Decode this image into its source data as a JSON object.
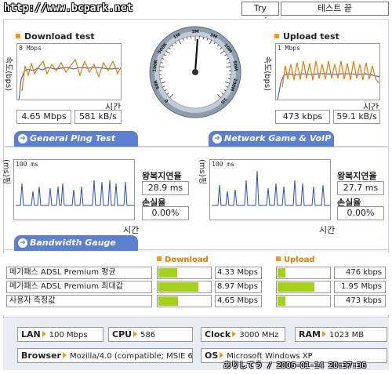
{
  "header": {
    "watermark": "http://www.bcpark.net",
    "try_again_label": "Try again",
    "end_test_label": "테스트 끝"
  },
  "download_test": {
    "title": "Download test",
    "ylabel": "속도(bps)",
    "ymax_label": "8 Mbps",
    "xlabel": "시간",
    "speed_mbps": "4.65 Mbps",
    "speed_kbs": "581 kB/s"
  },
  "upload_test": {
    "title": "Upload test",
    "ylabel": "속도(bps)",
    "ymax_label": "1 Mbps",
    "xlabel": "시간",
    "speed_kbps": "473 kbps",
    "speed_kbs": "59.1 kB/s"
  },
  "gauge": {
    "ticks": [
      "0",
      "50K",
      "100K",
      "500K",
      "1M",
      "3M",
      "5M",
      "10M",
      "50M",
      "100M",
      "1G"
    ],
    "needle_label": "4.65 Mbps"
  },
  "tabs": {
    "general_ping": "General Ping Test",
    "network_game": "Network Game & VoIP Test",
    "bandwidth_gauge": "Bandwidth Gauge"
  },
  "ping_general": {
    "ylabel": "(ms)핑",
    "ymax_label": "100 ms",
    "xlabel": "시간",
    "latency_label": "왕복지연율",
    "latency_value": "28.9 ms",
    "loss_label": "손실율",
    "loss_value": "0.00%"
  },
  "ping_game": {
    "ylabel": "(ms)핑",
    "ymax_label": "100 ms",
    "xlabel": "시간",
    "latency_label": "왕복지연율",
    "latency_value": "27.7 ms",
    "loss_label": "손실율",
    "loss_value": "0.00%"
  },
  "bandwidth": {
    "download_header": "Download",
    "upload_header": "Upload",
    "rows": [
      {
        "name": "메가패스 ADSL Premium 평균",
        "down": "4.33 Mbps",
        "down_fill": 0.38,
        "up": "476 kbps",
        "up_fill": 0.18
      },
      {
        "name": "메가패스 ADSL Premium 최대값",
        "down": "8.97 Mbps",
        "down_fill": 0.78,
        "up": "1.95 Mbps",
        "up_fill": 0.72
      },
      {
        "name": "사용자 측정값",
        "down": "4.65 Mbps",
        "down_fill": 0.4,
        "up": "473 kbps",
        "up_fill": 0.18
      }
    ]
  },
  "system": {
    "lan_label": "LAN",
    "lan_value": "100 Mbps",
    "cpu_label": "CPU",
    "cpu_value": "586",
    "clock_label": "Clock",
    "clock_value": "3000 MHz",
    "ram_label": "RAM",
    "ram_value": "1023 MB",
    "browser_label": "Browser",
    "browser_value": "Mozilla/4.0 (compatible; MSIE 6.0",
    "os_label": "OS",
    "os_value": "Microsoft Windows XP"
  },
  "timestamp": "ありしてう / 2006-01-14 20:37:36",
  "colors": {
    "accent_orange": "#f29a1e",
    "tab_blue": "#5d7fcf",
    "bar_green": "#a4d21c",
    "line_blue": "#2a4fb5",
    "line_orange": "#e87b00"
  }
}
